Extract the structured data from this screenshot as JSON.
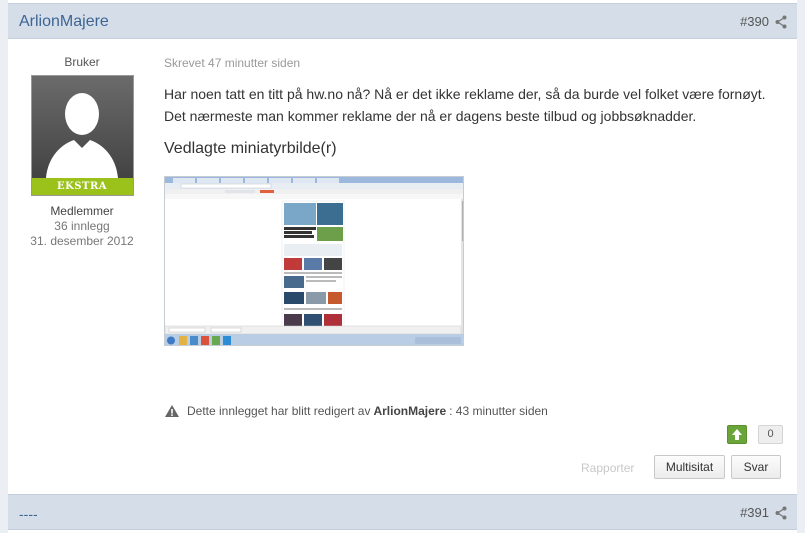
{
  "post": {
    "author": "ArlionMajere",
    "number": "#390",
    "group": "Bruker",
    "rank": "EKSTRA",
    "member_title": "Medlemmer",
    "post_count": "36 innlegg",
    "joined": "31. desember 2012",
    "posted": "Skrevet 47 minutter siden",
    "body_line1": "Har noen tatt en titt på hw.no nå? Nå er det ikke reklame der, så da burde vel folket være fornøyt.",
    "body_line2": "Det nærmeste man kommer reklame der nå er dagens beste tilbud og jobbsøknadder.",
    "attachments_title": "Vedlagte miniatyrbilde(r)",
    "edit_prefix": "Dette innlegget har blitt redigert av",
    "edit_user": "ArlionMajere",
    "edit_suffix": ": 43 minutter siden",
    "reputation": "0",
    "report_label": "Rapporter",
    "multiquote_label": "Multisitat",
    "reply_label": "Svar"
  },
  "next_post": {
    "author": "----",
    "number": "#391"
  },
  "icons": {
    "share": "share-icon",
    "warning": "warning-icon",
    "upvote": "thumbs-up-icon"
  },
  "colors": {
    "header_bg": "#d5dde8",
    "author_link": "#3d6594",
    "rank_badge": "#9bc21a",
    "upvote": "#6aa53a"
  }
}
